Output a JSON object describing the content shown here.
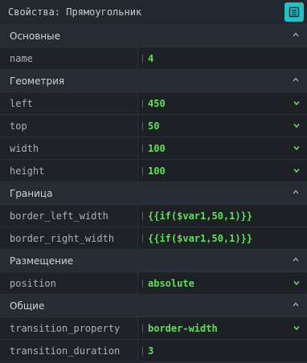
{
  "header": {
    "title": "Свойства: Прямоугольник",
    "button_icon": "panel-list-icon"
  },
  "sections": [
    {
      "title": "Основные",
      "rows": [
        {
          "label": "name",
          "value": "4",
          "dropdown": false
        }
      ]
    },
    {
      "title": "Геометрия",
      "rows": [
        {
          "label": "left",
          "value": "450",
          "dropdown": true
        },
        {
          "label": "top",
          "value": "50",
          "dropdown": true
        },
        {
          "label": "width",
          "value": "100",
          "dropdown": true
        },
        {
          "label": "height",
          "value": "100",
          "dropdown": true
        }
      ]
    },
    {
      "title": "Граница",
      "rows": [
        {
          "label": "border_left_width",
          "value": "{{if($var1,50,1)}}",
          "dropdown": false
        },
        {
          "label": "border_right_width",
          "value": "{{if($var1,50,1)}}",
          "dropdown": false
        }
      ]
    },
    {
      "title": "Размещение",
      "rows": [
        {
          "label": "position",
          "value": "absolute",
          "dropdown": true
        }
      ]
    },
    {
      "title": "Общие",
      "rows": [
        {
          "label": "transition_property",
          "value": "border-width",
          "dropdown": true
        },
        {
          "label": "transition_duration",
          "value": "3",
          "dropdown": false
        }
      ]
    }
  ],
  "colors": {
    "accent": "#23c0c4",
    "value_text": "#5fe05a",
    "marker": "#9a3e4d",
    "background": "#1d2125"
  }
}
